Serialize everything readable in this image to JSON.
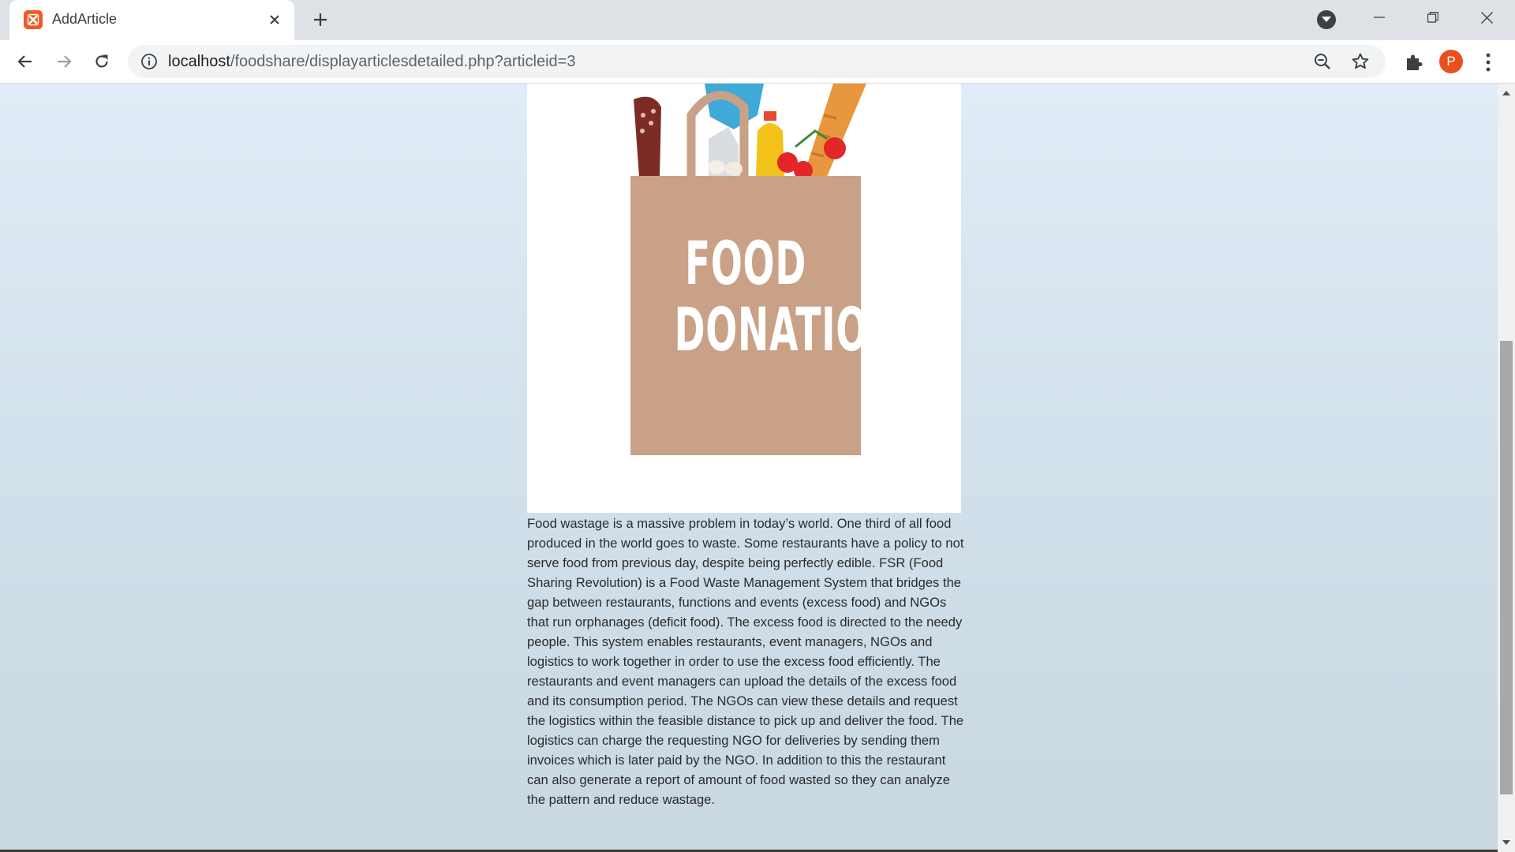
{
  "browser": {
    "tab_title": "AddArticle",
    "url_host": "localhost",
    "url_path": "/foodshare/displayarticlesdetailed.php?articleid=3",
    "profile_initial": "P",
    "icons": {
      "favicon": "xampp-favicon-icon",
      "tab_close": "close-icon",
      "new_tab": "plus-icon",
      "tab_search": "chevron-down-icon",
      "minimize": "minimize-icon",
      "restore": "restore-icon",
      "close_window": "close-icon",
      "back": "arrow-left-icon",
      "forward": "arrow-right-icon",
      "reload": "reload-icon",
      "site_info": "info-icon",
      "zoom": "zoom-out-icon",
      "bookmark": "star-icon",
      "extensions": "puzzle-icon",
      "menu": "kebab-menu-icon"
    },
    "colors": {
      "avatar": "#e8501e",
      "favicon": "#f15a22"
    }
  },
  "article": {
    "image_text_line1": "FOOD",
    "image_text_line2": "DONATION",
    "body": "Food wastage is a massive problem in today’s world. One third of all food produced in the world goes to waste. Some restaurants have a policy to not serve food from previous day, despite being perfectly edible. FSR (Food Sharing Revolution) is a Food Waste Management System that bridges the gap between restaurants, functions and events (excess food) and NGOs that run orphanages (deficit food). The excess food is directed to the needy people. This system enables restaurants, event managers, NGOs and logistics to work together in order to use the excess food efficiently. The restaurants and event managers can upload the details of the excess food and its consumption period. The NGOs can view these details and request the logistics within the feasible distance to pick up and deliver the food. The logistics can charge the requesting NGO for deliveries by sending them invoices which is later paid by the NGO. In addition to this the restaurant can also generate a report of amount of food wasted so they can analyze the pattern and reduce wastage."
  }
}
